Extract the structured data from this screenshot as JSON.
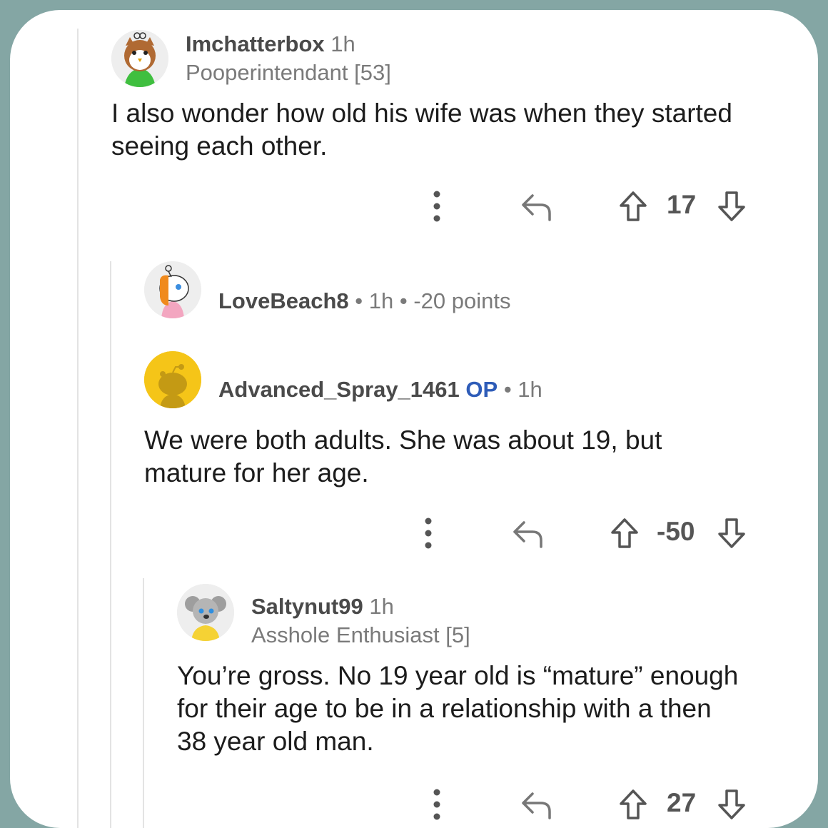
{
  "comments": [
    {
      "username": "Imchatterbox",
      "time": "1h",
      "flair": "Pooperintendant [53]",
      "body": "I also wonder how old his wife was when they started seeing each other.",
      "score": "17"
    },
    {
      "username": "LoveBeach8",
      "separator": "•",
      "time": "1h",
      "points": "-20 points"
    },
    {
      "username": "Advanced_Spray_1461",
      "op_badge": "OP",
      "separator": "•",
      "time": "1h",
      "body": "We were both adults. She was about 19, but mature for her age.",
      "score": "-50"
    },
    {
      "username": "Saltynut99",
      "time": "1h",
      "flair": "Asshole Enthusiast [5]",
      "body": "You’re gross. No 19 year old is “mature” enough for their age to be in a relationship with a then 38 year old man.",
      "score": "27"
    }
  ],
  "icons": {
    "more": "more-vertical-icon",
    "reply": "reply-arrow-icon",
    "upvote": "upvote-arrow-icon",
    "downvote": "downvote-arrow-icon"
  },
  "colors": {
    "background_frame": "#84a6a4",
    "op_badge": "#2e5cb8",
    "text": "#1c1c1c",
    "meta": "#7a7a7a"
  }
}
